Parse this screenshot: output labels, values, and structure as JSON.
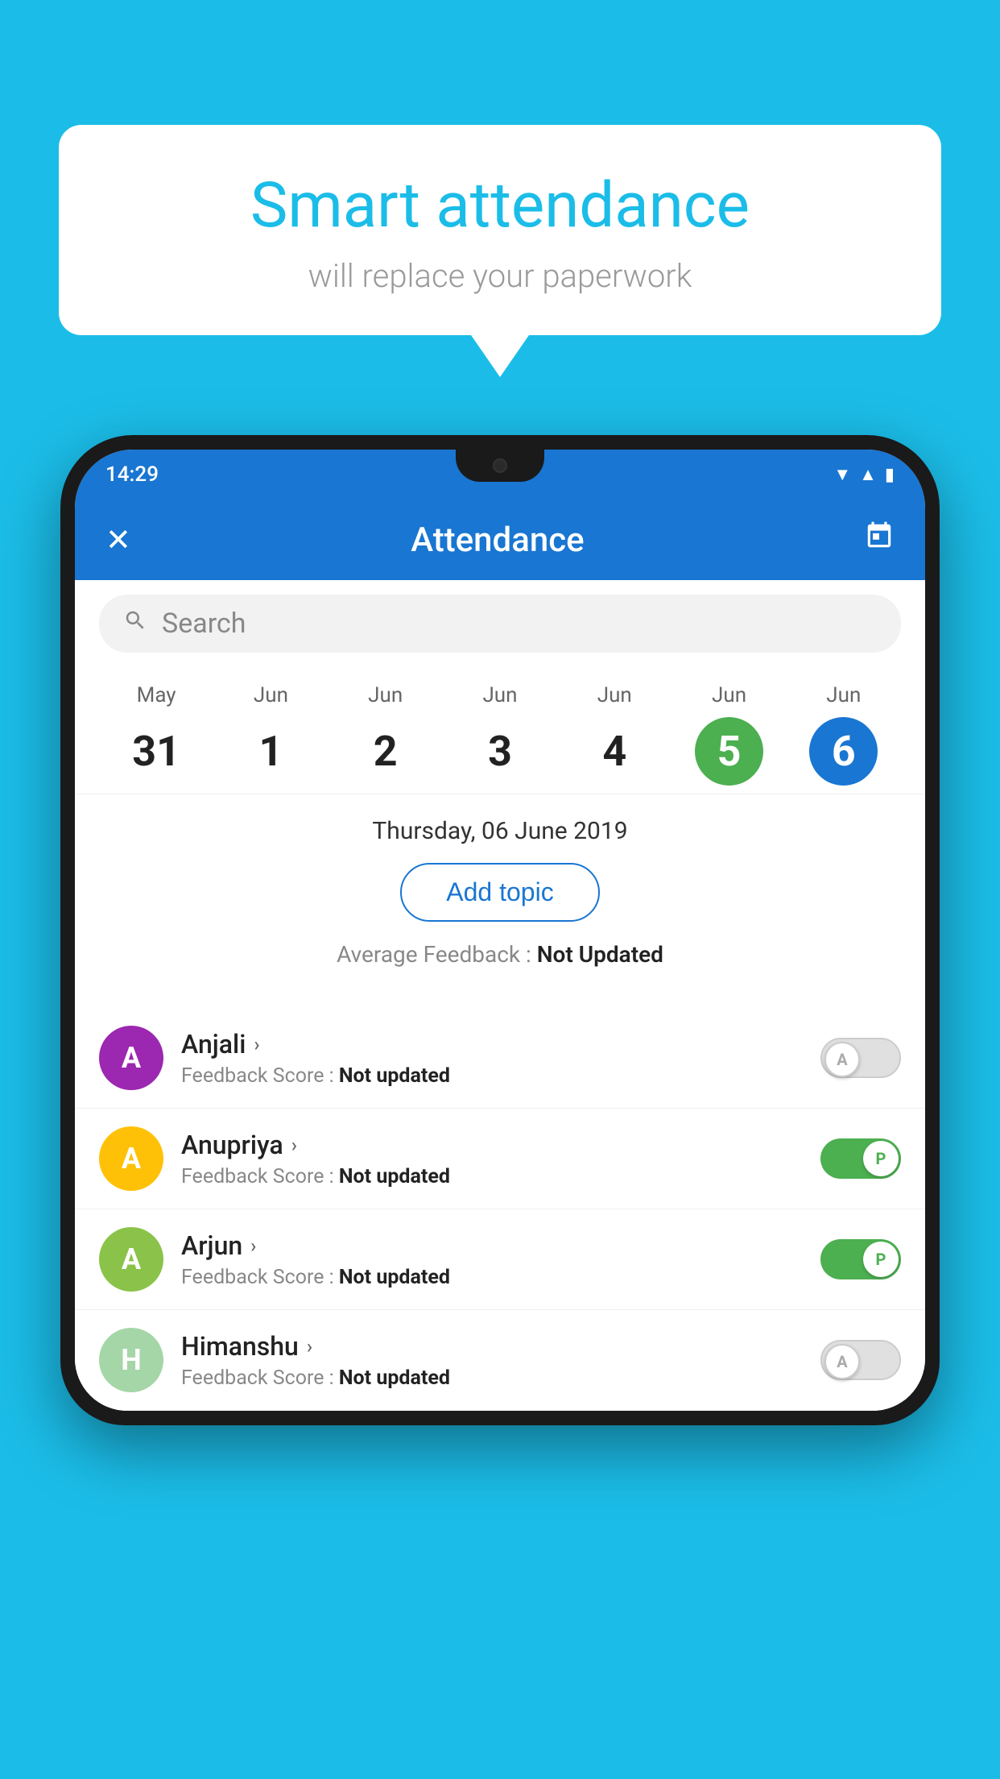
{
  "background_color": "#1BBDE8",
  "speech_bubble": {
    "title": "Smart attendance",
    "subtitle": "will replace your paperwork"
  },
  "status_bar": {
    "time": "14:29",
    "icons": [
      "wifi",
      "signal",
      "battery"
    ]
  },
  "app_bar": {
    "title": "Attendance",
    "close_label": "✕",
    "calendar_label": "📅"
  },
  "search": {
    "placeholder": "Search"
  },
  "calendar": {
    "days": [
      {
        "month": "May",
        "date": "31",
        "style": "normal"
      },
      {
        "month": "Jun",
        "date": "1",
        "style": "normal"
      },
      {
        "month": "Jun",
        "date": "2",
        "style": "normal"
      },
      {
        "month": "Jun",
        "date": "3",
        "style": "normal"
      },
      {
        "month": "Jun",
        "date": "4",
        "style": "normal"
      },
      {
        "month": "Jun",
        "date": "5",
        "style": "today"
      },
      {
        "month": "Jun",
        "date": "6",
        "style": "selected"
      }
    ]
  },
  "selected_date": "Thursday, 06 June 2019",
  "add_topic_label": "Add topic",
  "avg_feedback_label": "Average Feedback :",
  "avg_feedback_value": "Not Updated",
  "students": [
    {
      "name": "Anjali",
      "initial": "A",
      "avatar_color": "#9C27B0",
      "feedback_label": "Feedback Score :",
      "feedback_value": "Not updated",
      "toggle": "off",
      "toggle_letter": "A"
    },
    {
      "name": "Anupriya",
      "initial": "A",
      "avatar_color": "#FFC107",
      "feedback_label": "Feedback Score :",
      "feedback_value": "Not updated",
      "toggle": "on",
      "toggle_letter": "P"
    },
    {
      "name": "Arjun",
      "initial": "A",
      "avatar_color": "#8BC34A",
      "feedback_label": "Feedback Score :",
      "feedback_value": "Not updated",
      "toggle": "on",
      "toggle_letter": "P"
    },
    {
      "name": "Himanshu",
      "initial": "H",
      "avatar_color": "#A5D6A7",
      "feedback_label": "Feedback Score :",
      "feedback_value": "Not updated",
      "toggle": "off",
      "toggle_letter": "A"
    }
  ]
}
